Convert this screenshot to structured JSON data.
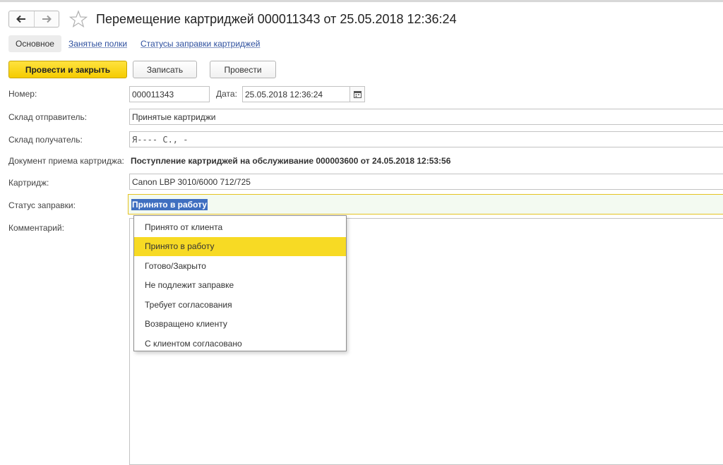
{
  "header": {
    "title": "Перемещение картриджей 000011343 от 25.05.2018 12:36:24",
    "icons": {
      "back": "arrow-left-icon",
      "forward": "arrow-right-icon",
      "favorite": "star-icon"
    }
  },
  "tabs": [
    {
      "label": "Основное",
      "active": true
    },
    {
      "label": "Занятые полки",
      "active": false
    },
    {
      "label": "Статусы заправки картриджей",
      "active": false
    }
  ],
  "toolbar": {
    "post_close_label": "Провести и закрыть",
    "save_label": "Записать",
    "post_label": "Провести"
  },
  "form": {
    "number_label": "Номер:",
    "number_value": "000011343",
    "date_label": "Дата:",
    "date_value": "25.05.2018 12:36:24",
    "sender_label": "Склад отправитель:",
    "sender_value": "Принятые картриджи",
    "receiver_label": "Склад получатель:",
    "receiver_value": "Я---- С., -",
    "doc_label": "Документ приема картриджа:",
    "doc_value": "Поступление картриджей на обслуживание 000003600 от 24.05.2018 12:53:56",
    "cartridge_label": "Картридж:",
    "cartridge_value": "Canon LBP 3010/6000   712/725",
    "status_label": "Статус заправки:",
    "status_value": "Принято в работу",
    "comment_label": "Комментарий:"
  },
  "dropdown": {
    "options": [
      "Принято от клиента",
      "Принято в работу",
      "Готово/Закрыто",
      "Не подлежит заправке",
      "Требует согласования",
      "Возвращено клиенту",
      "С клиентом согласовано"
    ],
    "selected_index": 1
  },
  "colors": {
    "accent_yellow": "#f7da24",
    "selection_blue": "#3f6fc0",
    "link_blue": "#2d4f9e"
  }
}
